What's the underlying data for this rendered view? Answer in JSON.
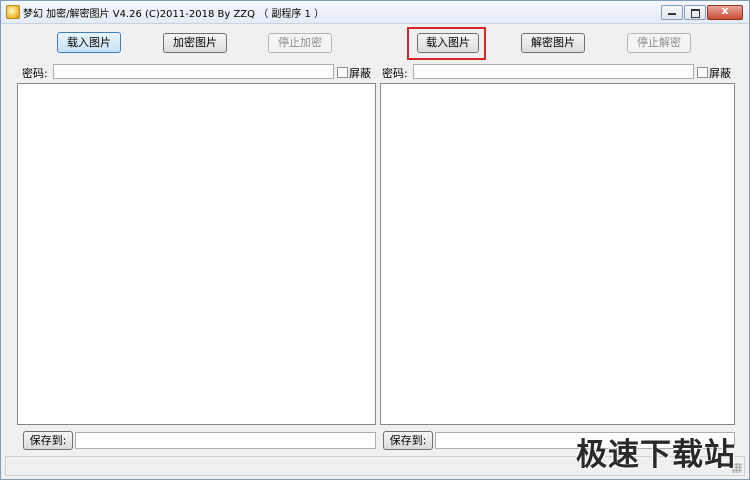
{
  "window": {
    "title": "梦幻 加密/解密图片 V4.26  (C)2011-2018 By ZZQ （ 副程序 1 ）",
    "close_glyph": "x"
  },
  "encrypt": {
    "load_button": "载入图片",
    "encrypt_button": "加密图片",
    "stop_button": "停止加密",
    "password_label": "密码:",
    "password_value": "",
    "mask_label": "屏蔽",
    "save_button": "保存到:",
    "save_path": ""
  },
  "decrypt": {
    "load_button": "载入图片",
    "decrypt_button": "解密图片",
    "stop_button": "停止解密",
    "password_label": "密码:",
    "password_value": "",
    "mask_label": "屏蔽",
    "save_button": "保存到:",
    "save_path": ""
  },
  "watermark": "极速下载站",
  "colors": {
    "highlight": "#d8252a",
    "focus_border": "#3c7fb1"
  }
}
